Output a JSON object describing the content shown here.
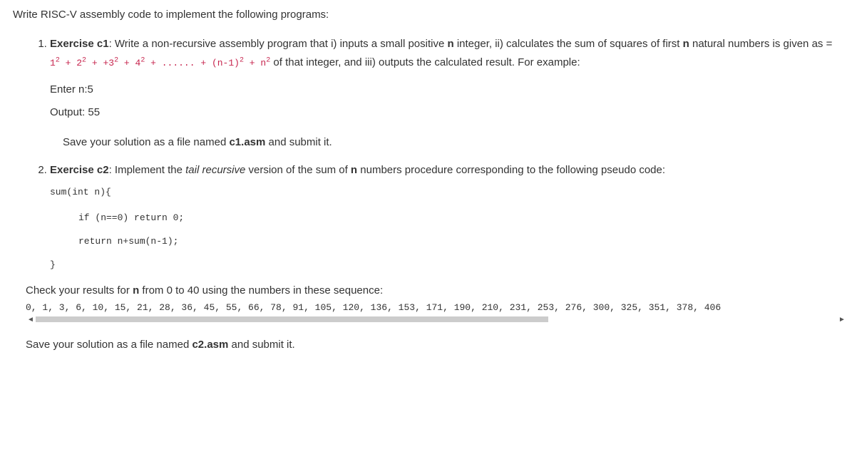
{
  "intro": "Write RISC-V assembly code to implement the following programs:",
  "ex1": {
    "title": "Exercise c1",
    "desc_a": ":  Write a non-recursive assembly program that i) inputs a small positive ",
    "n_bold": "n",
    "desc_b": " integer, ii) calculates the sum of squares of first ",
    "desc_c": " natural numbers is given as = ",
    "formula": {
      "a": "1",
      "p": "2",
      "plus": " + ",
      "b": "2",
      "c": "+3",
      "d": "4",
      "dots": " + ...... + ",
      "e": "(n-1)",
      "f": "n"
    },
    "desc_d": " of that integer, and iii) outputs the calculated result. For example:",
    "enter": "Enter n:5",
    "output": "Output: 55",
    "save_a": "Save your solution as a file named ",
    "file": "c1.asm",
    "save_b": " and submit it."
  },
  "ex2": {
    "title": "Exercise c2",
    "desc_a": ": Implement the ",
    "tail": "tail recursive",
    "desc_b": " version of the sum of ",
    "n_bold": "n",
    "desc_c": " numbers procedure corresponding to the following pseudo code:",
    "code": {
      "l1": "sum(int n){",
      "l2": "if (n==0) return 0;",
      "l3": "return n+sum(n-1);",
      "l4": "}"
    },
    "check_a": "Check your results for ",
    "check_b": " from 0 to 40 using the numbers in these sequence:",
    "seq": "0, 1, 3, 6, 10, 15, 21, 28, 36, 45, 55, 66, 78, 91, 105, 120, 136, 153, 171, 190, 210, 231, 253, 276, 300, 325, 351, 378, 406",
    "save_a": "Save your solution as a file named ",
    "file": "c2.asm",
    "save_b": " and submit it."
  }
}
